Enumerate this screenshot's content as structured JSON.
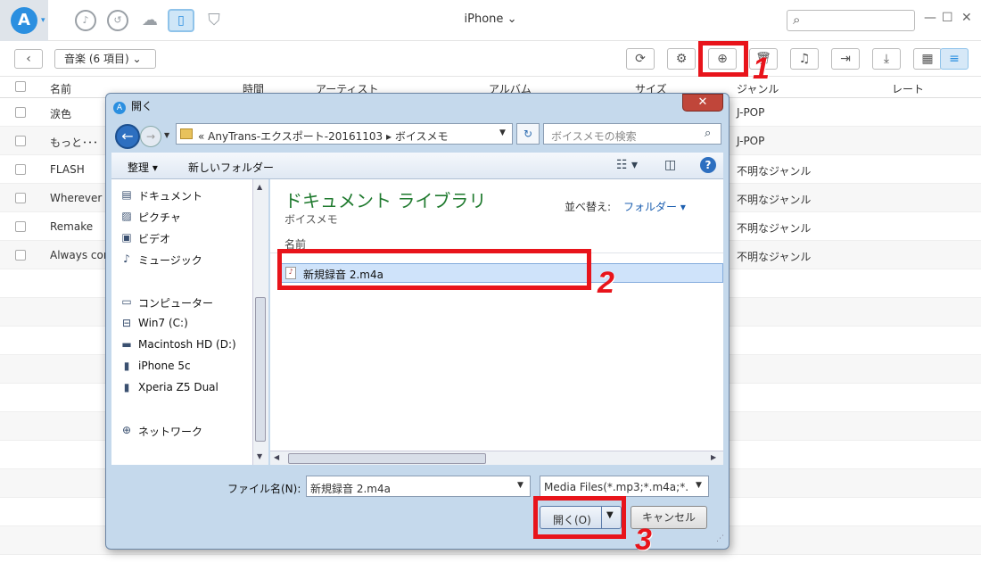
{
  "app": {
    "device_title": "iPhone"
  },
  "topnav": {
    "search_placeholder": ""
  },
  "toolbar": {
    "category": "音楽 (6 項目)"
  },
  "table": {
    "headers": {
      "name": "名前",
      "time": "時間",
      "artist": "アーティスト",
      "album": "アルバム",
      "size": "サイズ",
      "genre": "ジャンル",
      "rate": "レート"
    },
    "rows": [
      {
        "name": "涙色",
        "genre": "J-POP"
      },
      {
        "name": "もっと･･･",
        "genre": "J-POP"
      },
      {
        "name": "FLASH",
        "genre": "不明なジャンル"
      },
      {
        "name": "Wherever yo",
        "genre": "不明なジャンル"
      },
      {
        "name": "Remake",
        "genre": "不明なジャンル"
      },
      {
        "name": "Always com",
        "genre": "不明なジャンル"
      }
    ]
  },
  "dialog": {
    "title": "開く",
    "address_path": "«  AnyTrans-エクスポート-20161103  ▸ ボイスメモ",
    "search_placeholder": "ボイスメモの検索",
    "organize": "整理 ▾",
    "new_folder": "新しいフォルダー",
    "nav_items": [
      "ドキュメント",
      "ピクチャ",
      "ビデオ",
      "ミュージック",
      "コンピューター",
      "Win7 (C:)",
      "Macintosh HD (D:)",
      "iPhone 5c",
      "Xperia Z5 Dual",
      "ネットワーク"
    ],
    "library_title": "ドキュメント ライブラリ",
    "library_subtitle": "ボイスメモ",
    "sort_label": "並べ替え:",
    "sort_value": "フォルダー ▾",
    "column_name": "名前",
    "file_name": "新規録音 2.m4a",
    "filename_label": "ファイル名(N):",
    "filename_value": "新規録音 2.m4a",
    "filetype_value": "Media Files(*.mp3;*.m4a;*.",
    "open_label": "開く(O)",
    "cancel_label": "キャンセル"
  },
  "steps": [
    "1",
    "2",
    "3"
  ],
  "colors": {
    "accent": "#2b8fe0",
    "highlight": "#e8141b"
  }
}
